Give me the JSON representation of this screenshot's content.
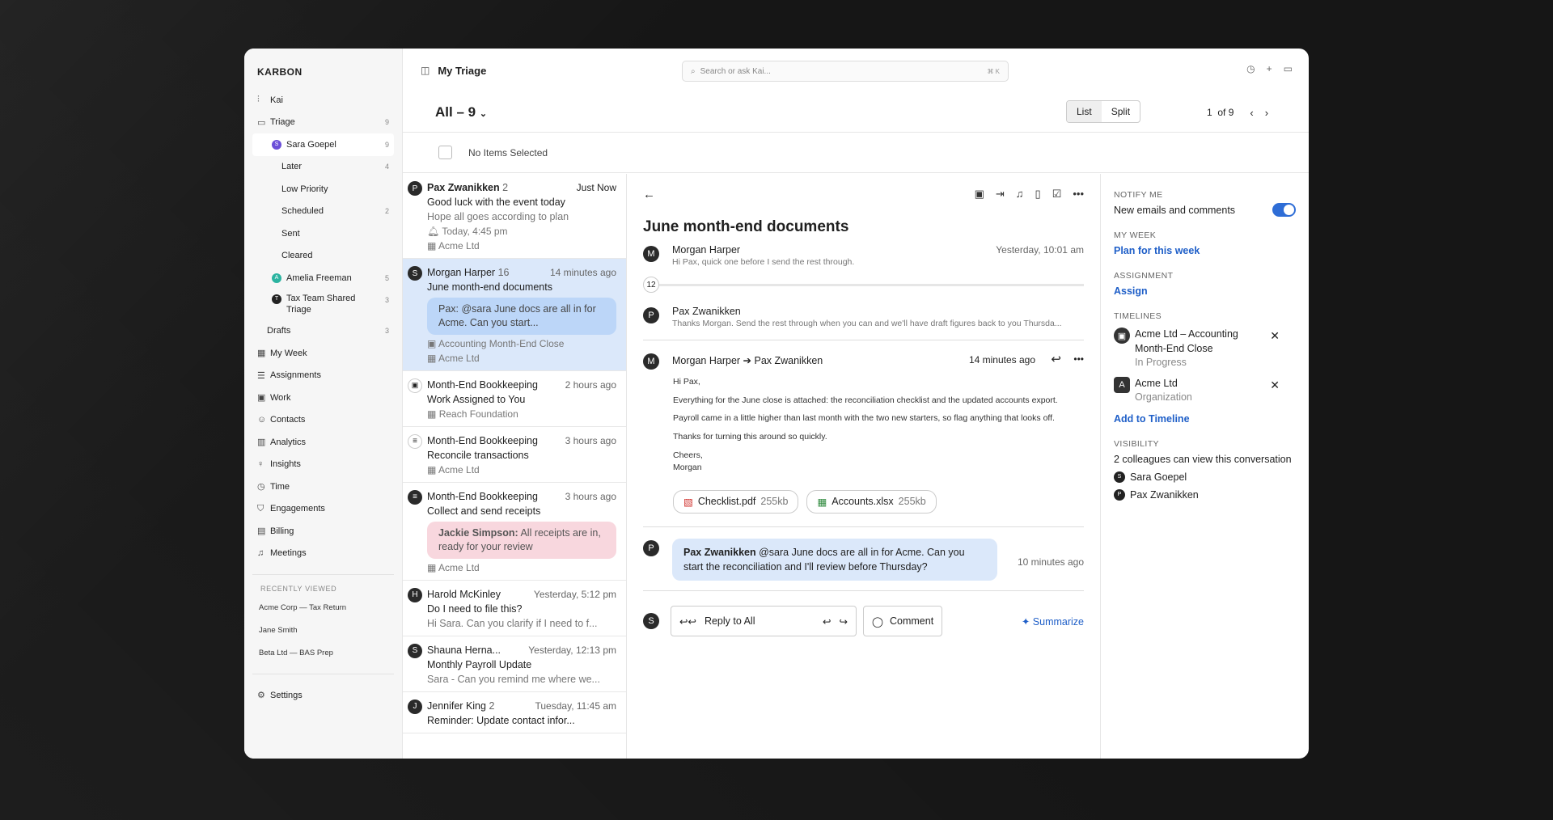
{
  "brand": "KARBON",
  "sidebar": {
    "items": [
      {
        "icon": "kai-icon",
        "label": "Kai",
        "count": ""
      },
      {
        "icon": "inbox-icon",
        "label": "Triage",
        "count": "9"
      },
      {
        "label": "Sara Goepel",
        "count": "9",
        "avatar": "S",
        "color": "#6b4fd8"
      },
      {
        "label": "Later",
        "count": "4"
      },
      {
        "label": "Low Priority",
        "count": ""
      },
      {
        "label": "Scheduled",
        "count": "2"
      },
      {
        "label": "Sent",
        "count": ""
      },
      {
        "label": "Cleared",
        "count": ""
      },
      {
        "label": "Amelia Freeman",
        "count": "5",
        "avatar": "A",
        "color": "#2bb3a0"
      },
      {
        "label": "Tax Team Shared Triage",
        "count": "3",
        "avatar": "T",
        "color": "#222222"
      },
      {
        "label": "Drafts",
        "count": "3"
      },
      {
        "label": "My Week"
      },
      {
        "label": "Assignments"
      },
      {
        "label": "Work"
      },
      {
        "label": "Contacts"
      },
      {
        "label": "Analytics"
      },
      {
        "label": "Insights"
      },
      {
        "label": "Time"
      },
      {
        "label": "Engagements"
      },
      {
        "label": "Billing"
      },
      {
        "label": "Meetings"
      }
    ],
    "recent_title": "RECENTLY VIEWED",
    "recent": [
      "Acme Corp — Tax Return",
      "Jane Smith",
      "Beta Ltd — BAS Prep"
    ],
    "settings": "Settings"
  },
  "topbar": {
    "title": "My Triage",
    "search_placeholder": "Search or ask Kai...",
    "search_kbd": "⌘ K"
  },
  "header": {
    "all": "All – 9",
    "view_list": "List",
    "view_split": "Split",
    "page": "1",
    "of": "of 9",
    "no_items": "No Items Selected"
  },
  "list": [
    {
      "avatar": "P",
      "who": "Pax Zwanikken",
      "count": "2",
      "time": "Just Now",
      "subject": "Good luck with the event today",
      "snippet": "Hope all goes according to plan",
      "reminder": "Today, 4:45 pm",
      "org": "Acme Ltd"
    },
    {
      "avatar": "S",
      "who": "Morgan Harper",
      "count": "16",
      "time": "14 minutes ago",
      "subject": "June month-end documents",
      "bubble": "Pax: @sara June docs are all in for Acme. Can you start...",
      "work": "Accounting Month-End Close",
      "org": "Acme Ltd"
    },
    {
      "avatar": "▣",
      "who": "Month-End Bookkeeping",
      "time": "2 hours ago",
      "subject": "Work Assigned to You",
      "org": "Reach Foundation"
    },
    {
      "avatar": "≡",
      "who": "Month-End Bookkeeping",
      "time": "3 hours ago",
      "subject": "Reconcile transactions",
      "org": "Acme Ltd"
    },
    {
      "avatar": "≡",
      "who": "Month-End Bookkeeping",
      "time": "3 hours ago",
      "subject": "Collect and send receipts",
      "bubble_name": "Jackie Simpson:",
      "bubble": "All receipts are in, ready for your review",
      "org": "Acme Ltd"
    },
    {
      "avatar": "H",
      "who": "Harold McKinley",
      "time": "Yesterday, 5:12 pm",
      "subject": "Do I need to file this?",
      "snippet": "Hi Sara. Can you clarify if I need to f..."
    },
    {
      "avatar": "S",
      "who": "Shauna Herna...",
      "time": "Yesterday, 12:13 pm",
      "subject": "Monthly Payroll Update",
      "snippet": "Sara - Can you remind me where we..."
    },
    {
      "avatar": "J",
      "who": "Jennifer King",
      "count": "2",
      "time": "Tuesday, 11:45 am",
      "subject": "Reminder: Update contact infor..."
    }
  ],
  "detail": {
    "title": "June month-end documents",
    "msg1": {
      "avatar": "M",
      "from": "Morgan Harper",
      "preview": "Hi Pax, quick one before I send the rest through.",
      "time": "Yesterday, 10:01 am"
    },
    "collapsed_count": "12",
    "msg2": {
      "avatar": "P",
      "from": "Pax Zwanikken",
      "preview": "Thanks Morgan. Send the rest through when you can and we'll have draft figures back to you Thursda..."
    },
    "msg3": {
      "avatar": "M",
      "from": "Morgan Harper ➔ Pax Zwanikken",
      "time": "14 minutes ago",
      "body": [
        "Hi Pax,",
        "Everything for the June close is attached: the reconciliation checklist and the updated accounts export.",
        "Payroll came in a little higher than last month with the two new starters, so flag anything that looks off.",
        "Thanks for turning this around so quickly.",
        "Cheers,",
        "Morgan"
      ]
    },
    "attachments": [
      {
        "name": "Checklist.pdf",
        "size": "255kb",
        "color": "#d0312d"
      },
      {
        "name": "Accounts.xlsx",
        "size": "255kb",
        "color": "#2f8a3e"
      }
    ],
    "comment": {
      "avatar": "P",
      "who": "Pax Zwanikken",
      "text": "@sara June docs are all in for Acme. Can you start the reconciliation and I'll review before Thursday?",
      "time": "10 minutes ago"
    },
    "reply_all": "Reply to All",
    "comment_btn": "Comment",
    "summarize": "Summarize"
  },
  "panel": {
    "notify_title": "NOTIFY ME",
    "notify_value": "New emails and comments",
    "week_title": "MY WEEK",
    "week_link": "Plan for this week",
    "assign_title": "ASSIGNMENT",
    "assign_link": "Assign",
    "timelines_title": "TIMELINES",
    "timelines": [
      {
        "name": "Acme Ltd – Accounting Month-End Close",
        "sub": "In Progress",
        "icon": "▣"
      },
      {
        "name": "Acme Ltd",
        "sub": "Organization",
        "icon": "A"
      }
    ],
    "add_timeline": "Add to Timeline",
    "visibility_title": "VISIBILITY",
    "visibility_text": "2 colleagues can view this conversation",
    "viewers": [
      {
        "avatar": "S",
        "name": "Sara Goepel"
      },
      {
        "avatar": "P",
        "name": "Pax Zwanikken"
      }
    ]
  }
}
